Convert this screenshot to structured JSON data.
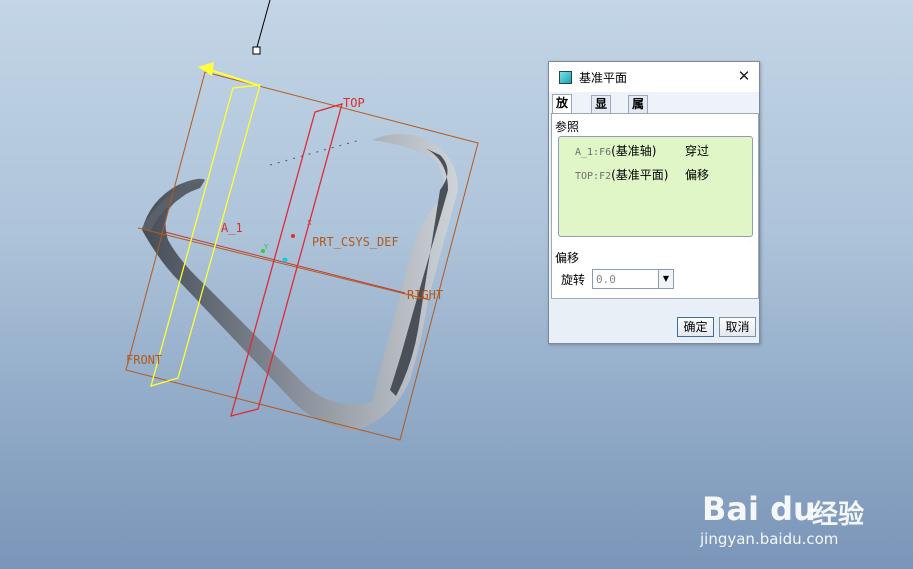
{
  "viewport": {
    "plane_labels": {
      "top": "TOP",
      "front": "FRONT",
      "right": "RIGHT",
      "csys": "PRT_CSYS_DEF",
      "axis": "A_1"
    }
  },
  "dialog": {
    "title": "基准平面",
    "tabs": [
      "放置",
      "显示",
      "属性"
    ],
    "active_tab": "放置",
    "references_label": "参照",
    "references": [
      {
        "id": "A_1:F6",
        "name": "(基准轴)",
        "constraint": "穿过"
      },
      {
        "id": "TOP:F2",
        "name": "(基准平面)",
        "constraint": "偏移"
      }
    ],
    "offset_label": "偏移",
    "rotate_label": "旋转",
    "rotate_value": "0.0",
    "ok_label": "确定",
    "cancel_label": "取消"
  },
  "watermark": {
    "logo": "Bai du",
    "brand_cn": "经验",
    "url": "jingyan.baidu.com"
  }
}
